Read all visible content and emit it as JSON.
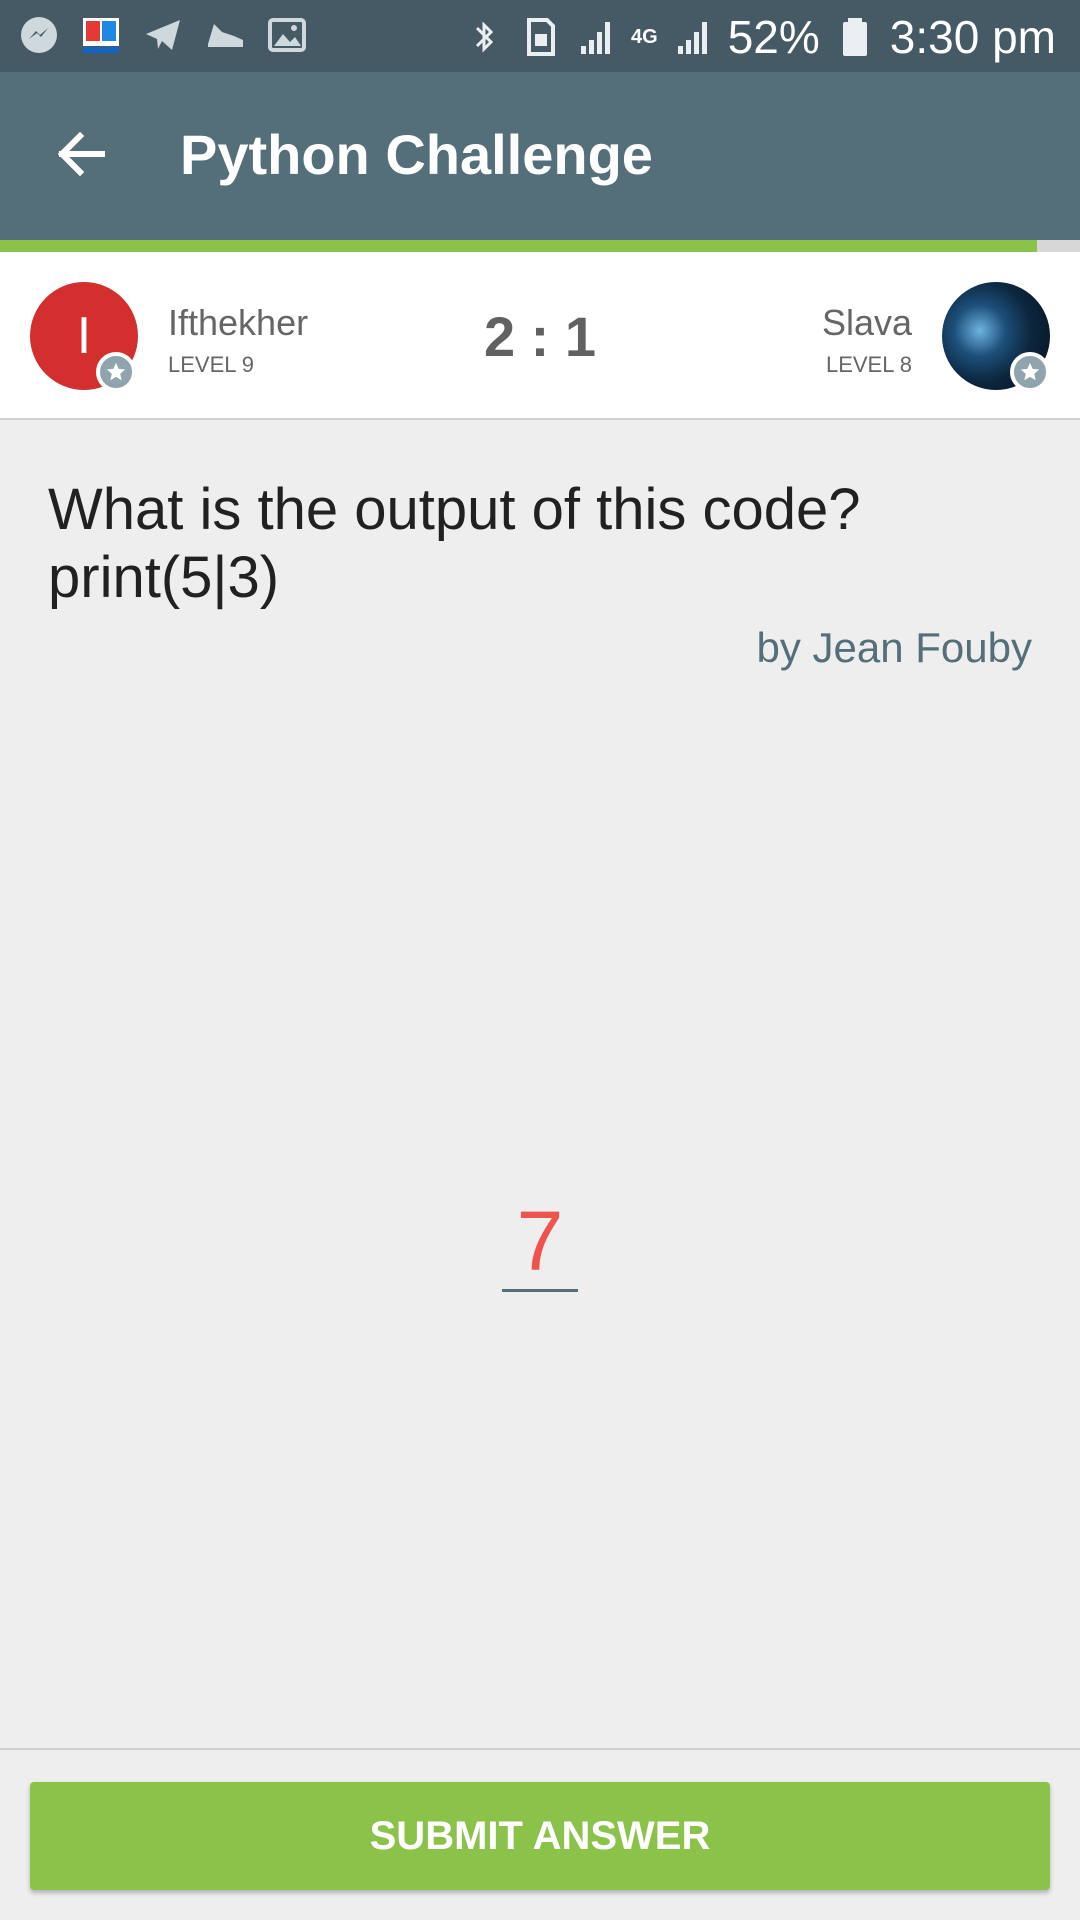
{
  "status_bar": {
    "battery": "52%",
    "time": "3:30 pm",
    "network": "4G",
    "icons": [
      "messenger-icon",
      "book-app-icon",
      "telegram-icon",
      "shoe-icon",
      "image-icon",
      "bluetooth-icon",
      "sim-icon",
      "signal-icon",
      "battery-icon"
    ]
  },
  "app_bar": {
    "title": "Python Challenge",
    "back_icon": "back-arrow-icon"
  },
  "progress": {
    "fraction": 0.96,
    "fill_color": "#8bc34a"
  },
  "players": {
    "left": {
      "initial": "I",
      "name": "Ifthekher",
      "level": "LEVEL 9",
      "avatar_color": "#d32f2f"
    },
    "right": {
      "name": "Slava",
      "level": "LEVEL 8"
    },
    "score": "2 : 1"
  },
  "question": {
    "line1": "What is the output of this code?",
    "line2": "print(5|3)",
    "author": "by Jean Fouby"
  },
  "answer": {
    "value": "7",
    "color": "#ef5350"
  },
  "submit": {
    "label": "SUBMIT ANSWER",
    "color": "#8bc34a"
  },
  "colors": {
    "status_bar": "#455a64",
    "app_bar": "#546e7a",
    "background": "#eeeeee"
  }
}
